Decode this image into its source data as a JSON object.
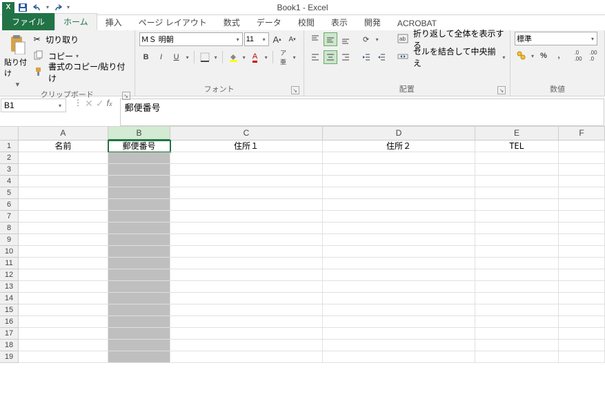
{
  "app": {
    "title": "Book1 - Excel"
  },
  "qat": {
    "save": "保存",
    "undo": "元に戻す",
    "redo": "やり直し"
  },
  "tabs": {
    "file": "ファイル",
    "home": "ホーム",
    "insert": "挿入",
    "layout": "ページ レイアウト",
    "formulas": "数式",
    "data": "データ",
    "review": "校閲",
    "view": "表示",
    "developer": "開発",
    "acrobat": "ACROBAT"
  },
  "ribbon": {
    "clipboard": {
      "paste": "貼り付け",
      "cut": "切り取り",
      "copy": "コピー",
      "format_painter": "書式のコピー/貼り付け",
      "group": "クリップボード"
    },
    "font": {
      "name": "ＭＳ 明朝",
      "size": "11",
      "group": "フォント"
    },
    "alignment": {
      "wrap": "折り返して全体を表示する",
      "merge": "セルを結合して中央揃え",
      "group": "配置"
    },
    "number": {
      "format": "標準",
      "group": "数値"
    }
  },
  "formula_bar": {
    "cell_ref": "B1",
    "value": "郵便番号"
  },
  "columns": [
    {
      "id": "A",
      "w": "wA"
    },
    {
      "id": "B",
      "w": "wB"
    },
    {
      "id": "C",
      "w": "wC"
    },
    {
      "id": "D",
      "w": "wD"
    },
    {
      "id": "E",
      "w": "wE"
    },
    {
      "id": "F",
      "w": "wF"
    }
  ],
  "selected_col": "B",
  "active_cell": {
    "r": 1,
    "c": "B"
  },
  "rows_visible": 19,
  "row1": {
    "A": "名前",
    "B": "郵便番号",
    "C": "住所１",
    "D": "住所２",
    "E": "TEL",
    "F": ""
  }
}
